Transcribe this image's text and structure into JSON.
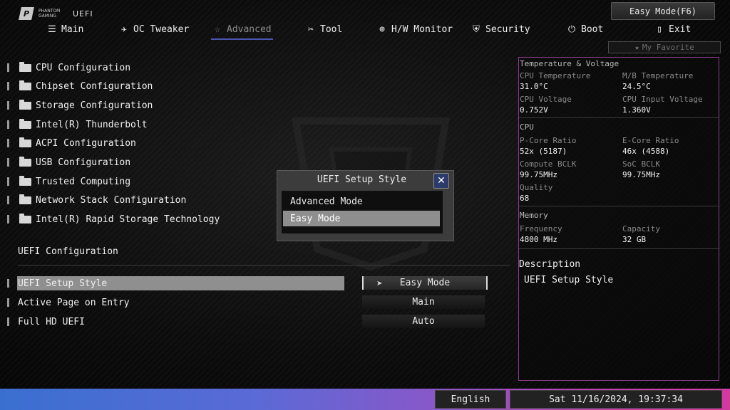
{
  "header": {
    "brand_line": "PHANTOM GAMING",
    "app_label": "UEFI",
    "mode_button": "Easy Mode(F6)",
    "favorite_label": "My Favorite"
  },
  "nav": {
    "tabs": [
      {
        "label": "Main",
        "icon": "list-icon"
      },
      {
        "label": "OC Tweaker",
        "icon": "rocket-icon"
      },
      {
        "label": "Advanced",
        "icon": "star-icon"
      },
      {
        "label": "Tool",
        "icon": "tools-icon"
      },
      {
        "label": "H/W Monitor",
        "icon": "crosshair-icon"
      },
      {
        "label": "Security",
        "icon": "shield-icon"
      },
      {
        "label": "Boot",
        "icon": "power-icon"
      },
      {
        "label": "Exit",
        "icon": "door-icon"
      }
    ],
    "active": "Advanced"
  },
  "menu": {
    "items": [
      "CPU Configuration",
      "Chipset Configuration",
      "Storage Configuration",
      "Intel(R) Thunderbolt",
      "ACPI Configuration",
      "USB Configuration",
      "Trusted Computing",
      "Network Stack Configuration",
      "Intel(R) Rapid Storage Technology"
    ]
  },
  "uefi_config": {
    "title": "UEFI Configuration",
    "options": [
      {
        "label": "UEFI Setup Style",
        "value": "Easy Mode"
      },
      {
        "label": "Active Page on Entry",
        "value": "Main"
      },
      {
        "label": "Full HD UEFI",
        "value": "Auto"
      }
    ]
  },
  "modal": {
    "title": "UEFI Setup Style",
    "options": [
      "Advanced Mode",
      "Easy Mode"
    ],
    "selected": "Easy Mode"
  },
  "panel": {
    "section_temp": "Temperature & Voltage",
    "cpu_temp_label": "CPU Temperature",
    "cpu_temp": "31.0°C",
    "mb_temp_label": "M/B Temperature",
    "mb_temp": "24.5°C",
    "cpu_volt_label": "CPU Voltage",
    "cpu_volt": "0.752V",
    "cpu_input_volt_label": "CPU Input Voltage",
    "cpu_input_volt": "1.360V",
    "section_cpu": "CPU",
    "pcore_label": "P-Core Ratio",
    "pcore": "52x (5187)",
    "ecore_label": "E-Core Ratio",
    "ecore": "46x (4588)",
    "compute_bclk_label": "Compute BCLK",
    "compute_bclk": "99.75MHz",
    "soc_bclk_label": "SoC BCLK",
    "soc_bclk": "99.75MHz",
    "quality_label": "Quality",
    "quality": "68",
    "section_memory": "Memory",
    "freq_label": "Frequency",
    "freq": "4800 MHz",
    "capacity_label": "Capacity",
    "capacity": "32 GB",
    "desc_title": "Description",
    "desc_text": "UEFI Setup Style"
  },
  "footer": {
    "language": "English",
    "datetime": "Sat 11/16/2024, 19:37:34"
  },
  "colors": {
    "accent_underline": "#4a55b0",
    "panel_border": "#8a3d8a",
    "highlight": "#8f8f8f"
  }
}
